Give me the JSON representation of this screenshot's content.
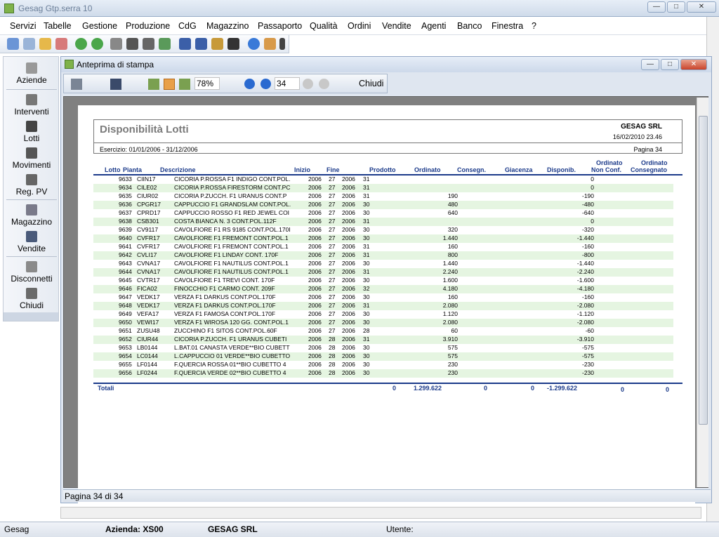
{
  "window": {
    "title": "Gesag Gtp.serra 10",
    "min": "—",
    "max": "□",
    "close": "✕"
  },
  "menu": [
    "Servizi",
    "Tabelle",
    "Gestione",
    "Produzione",
    "CdG",
    "Magazzino",
    "Passaporto",
    "Qualità",
    "Ordini",
    "Vendite",
    "Agenti",
    "Banco",
    "Finestra",
    "?"
  ],
  "sidebar": [
    {
      "label": "Aziende",
      "icon": "aziende-icon"
    },
    {
      "label": "Interventi",
      "icon": "interventi-icon"
    },
    {
      "label": "Lotti",
      "icon": "lotti-icon"
    },
    {
      "label": "Movimenti",
      "icon": "movimenti-icon"
    },
    {
      "label": "Reg. PV",
      "icon": "reg-pv-icon"
    },
    {
      "label": "Magazzino",
      "icon": "magazzino-icon"
    },
    {
      "label": "Vendite",
      "icon": "vendite-icon"
    },
    {
      "label": "Disconnetti",
      "icon": "disconnetti-icon"
    },
    {
      "label": "Chiudi",
      "icon": "chiudi-icon"
    }
  ],
  "preview": {
    "title": "Anteprima di stampa",
    "zoom": "78%",
    "page_input": "34",
    "close_label": "Chiudi",
    "status": "Pagina 34 di 34"
  },
  "report": {
    "title": "Disponibilità Lotti",
    "company": "GESAG SRL",
    "date": "16/02/2010  23.46",
    "esercizio": "Esercizio: 01/01/2006 - 31/12/2006",
    "pagina": "Pagina 34",
    "columns": {
      "lotto": "Lotto",
      "pianta": "Pianta",
      "descrizione": "Descrizione",
      "inizio": "Inizio",
      "fine": "Fine",
      "prodotto": "Prodotto",
      "ordinato": "Ordinato",
      "consegn": "Consegn.",
      "giacenza": "Giacenza",
      "disponib": "Disponib.",
      "ord_nc1": "Ordinato",
      "ord_nc2": "Non Conf.",
      "ord_c1": "Ordinato",
      "ord_c2": "Consegnato"
    },
    "rows": [
      {
        "lotto": "9633",
        "pianta": "CIIN17",
        "desc": "CICORIA P.ROSSA F1 INDIGO CONT.POL.",
        "iy": "2006",
        "iw": "27",
        "fy": "2006",
        "fw": "31",
        "ord": "",
        "disp": "0"
      },
      {
        "lotto": "9634",
        "pianta": "CILE02",
        "desc": "CICORIA P.ROSSA FIRESTORM CONT.PC",
        "iy": "2006",
        "iw": "27",
        "fy": "2006",
        "fw": "31",
        "ord": "",
        "disp": "0"
      },
      {
        "lotto": "9635",
        "pianta": "CIUR02",
        "desc": "CICORIA P.ZUCCH. F1 URANUS CONT.P",
        "iy": "2006",
        "iw": "27",
        "fy": "2006",
        "fw": "31",
        "ord": "190",
        "disp": "-190"
      },
      {
        "lotto": "9636",
        "pianta": "CPGR17",
        "desc": "CAPPUCCIO F1 GRANDSLAM CONT.POL.",
        "iy": "2006",
        "iw": "27",
        "fy": "2006",
        "fw": "30",
        "ord": "480",
        "disp": "-480"
      },
      {
        "lotto": "9637",
        "pianta": "CPRD17",
        "desc": "CAPPUCCIO ROSSO F1 RED JEWEL COI",
        "iy": "2006",
        "iw": "27",
        "fy": "2006",
        "fw": "30",
        "ord": "640",
        "disp": "-640"
      },
      {
        "lotto": "9638",
        "pianta": "CSB301",
        "desc": "COSTA BIANCA N. 3 CONT.POL.112F",
        "iy": "2006",
        "iw": "27",
        "fy": "2006",
        "fw": "31",
        "ord": "",
        "disp": "0"
      },
      {
        "lotto": "9639",
        "pianta": "CV9117",
        "desc": "CAVOLFIORE F1 RS 9185 CONT.POL.170I",
        "iy": "2006",
        "iw": "27",
        "fy": "2006",
        "fw": "30",
        "ord": "320",
        "disp": "-320"
      },
      {
        "lotto": "9640",
        "pianta": "CVFR17",
        "desc": "CAVOLFIORE F1 FREMONT CONT.POL.1",
        "iy": "2006",
        "iw": "27",
        "fy": "2006",
        "fw": "30",
        "ord": "1.440",
        "disp": "-1.440"
      },
      {
        "lotto": "9641",
        "pianta": "CVFR17",
        "desc": "CAVOLFIORE F1 FREMONT CONT.POL.1",
        "iy": "2006",
        "iw": "27",
        "fy": "2006",
        "fw": "31",
        "ord": "160",
        "disp": "-160"
      },
      {
        "lotto": "9642",
        "pianta": "CVLI17",
        "desc": "CAVOLFIORE F1 LINDAY CONT. 170F",
        "iy": "2006",
        "iw": "27",
        "fy": "2006",
        "fw": "31",
        "ord": "800",
        "disp": "-800"
      },
      {
        "lotto": "9643",
        "pianta": "CVNA17",
        "desc": "CAVOLFIORE F1 NAUTILUS CONT.POL.1",
        "iy": "2006",
        "iw": "27",
        "fy": "2006",
        "fw": "30",
        "ord": "1.440",
        "disp": "-1.440"
      },
      {
        "lotto": "9644",
        "pianta": "CVNA17",
        "desc": "CAVOLFIORE F1 NAUTILUS CONT.POL.1",
        "iy": "2006",
        "iw": "27",
        "fy": "2006",
        "fw": "31",
        "ord": "2.240",
        "disp": "-2.240"
      },
      {
        "lotto": "9645",
        "pianta": "CVTR17",
        "desc": "CAVOLFIORE F1 TREVI CONT. 170F",
        "iy": "2006",
        "iw": "27",
        "fy": "2006",
        "fw": "30",
        "ord": "1.600",
        "disp": "-1.600"
      },
      {
        "lotto": "9646",
        "pianta": "FICA02",
        "desc": "FINOCCHIO F1 CARMO CONT. 209F",
        "iy": "2006",
        "iw": "27",
        "fy": "2006",
        "fw": "32",
        "ord": "4.180",
        "disp": "-4.180"
      },
      {
        "lotto": "9647",
        "pianta": "VEDK17",
        "desc": "VERZA F1 DARKUS CONT.POL.170F",
        "iy": "2006",
        "iw": "27",
        "fy": "2006",
        "fw": "30",
        "ord": "160",
        "disp": "-160"
      },
      {
        "lotto": "9648",
        "pianta": "VEDK17",
        "desc": "VERZA F1 DARKUS CONT.POL.170F",
        "iy": "2006",
        "iw": "27",
        "fy": "2006",
        "fw": "31",
        "ord": "2.080",
        "disp": "-2.080"
      },
      {
        "lotto": "9649",
        "pianta": "VEFA17",
        "desc": "VERZA F1 FAMOSA CONT.POL.170F",
        "iy": "2006",
        "iw": "27",
        "fy": "2006",
        "fw": "30",
        "ord": "1.120",
        "disp": "-1.120"
      },
      {
        "lotto": "9650",
        "pianta": "VEWI17",
        "desc": "VERZA F1 WIROSA 120 GG. CONT.POL.1",
        "iy": "2006",
        "iw": "27",
        "fy": "2006",
        "fw": "30",
        "ord": "2.080",
        "disp": "-2.080"
      },
      {
        "lotto": "9651",
        "pianta": "ZUSU48",
        "desc": "ZUCCHINO F1 SITOS CONT.POL.60F",
        "iy": "2006",
        "iw": "27",
        "fy": "2006",
        "fw": "28",
        "ord": "60",
        "disp": "-60"
      },
      {
        "lotto": "9652",
        "pianta": "CIUR44",
        "desc": "CICORIA P.ZUCCH. F1 URANUS CUBETI",
        "iy": "2006",
        "iw": "28",
        "fy": "2006",
        "fw": "31",
        "ord": "3.910",
        "disp": "-3.910"
      },
      {
        "lotto": "9653",
        "pianta": "LB0144",
        "desc": "L.BAT.01 CANASTA VERDE**BIO CUBETT",
        "iy": "2006",
        "iw": "28",
        "fy": "2006",
        "fw": "30",
        "ord": "575",
        "disp": "-575"
      },
      {
        "lotto": "9654",
        "pianta": "LC0144",
        "desc": "L.CAPPUCCIO 01 VERDE**BIO CUBETTO",
        "iy": "2006",
        "iw": "28",
        "fy": "2006",
        "fw": "30",
        "ord": "575",
        "disp": "-575"
      },
      {
        "lotto": "9655",
        "pianta": "LF0144",
        "desc": "F.QUERCIA ROSSA 01**BIO CUBETTO 4",
        "iy": "2006",
        "iw": "28",
        "fy": "2006",
        "fw": "30",
        "ord": "230",
        "disp": "-230"
      },
      {
        "lotto": "9656",
        "pianta": "LF0244",
        "desc": "F.QUERCIA VERDE 02**BIO CUBETTO 4",
        "iy": "2006",
        "iw": "28",
        "fy": "2006",
        "fw": "30",
        "ord": "230",
        "disp": "-230"
      }
    ],
    "totals": {
      "label": "Totali",
      "prodotto": "0",
      "ordinato": "1.299.622",
      "consegn": "0",
      "giacenza": "0",
      "disponib": "-1.299.622",
      "ord_nc": "0",
      "ord_c": "0"
    }
  },
  "statusbar": {
    "app": "Gesag",
    "azienda": "Azienda: XS00",
    "company": "GESAG SRL",
    "utente": "Utente:"
  }
}
